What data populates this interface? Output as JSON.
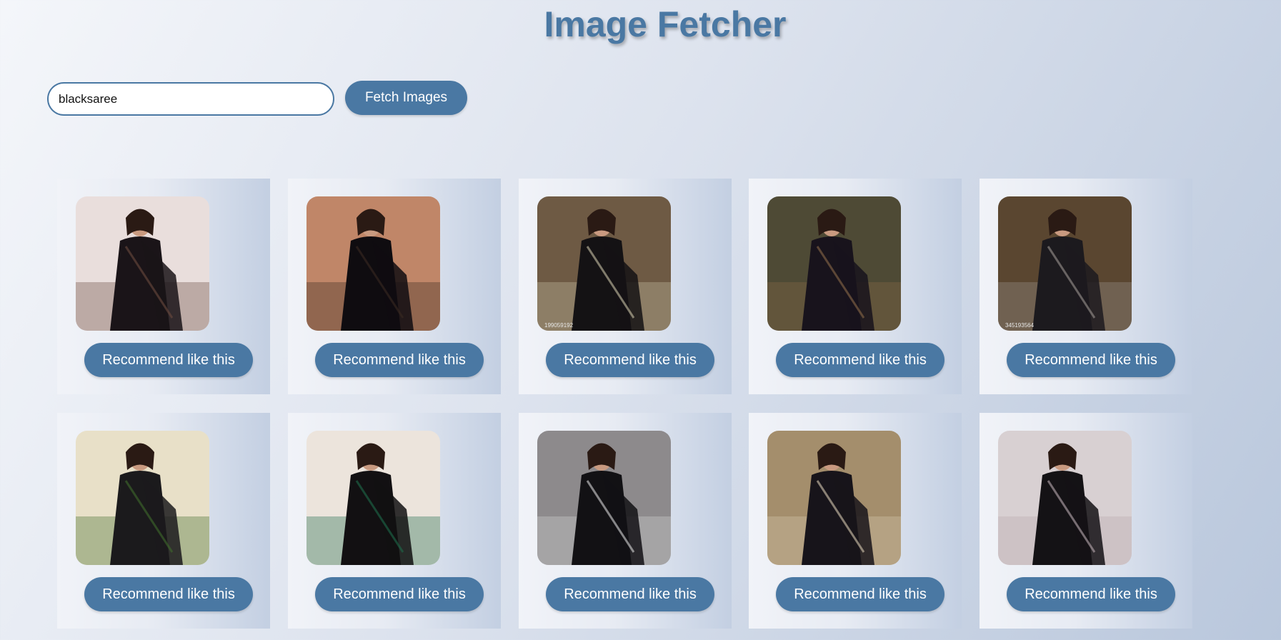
{
  "app": {
    "title": "Image Fetcher"
  },
  "search": {
    "value": "blacksaree",
    "button_label": "Fetch Images"
  },
  "results": [
    {
      "recommend_label": "Recommend like this",
      "bg": "#e9dedc",
      "figure": "#1a1418",
      "accent": "#6b4a3e",
      "caption": ""
    },
    {
      "recommend_label": "Recommend like this",
      "bg": "#c08668",
      "figure": "#0f0c10",
      "accent": "#3a2a22",
      "caption": ""
    },
    {
      "recommend_label": "Recommend like this",
      "bg": "#6e5a44",
      "figure": "#141214",
      "accent": "#c9c2a6",
      "caption": "199059192"
    },
    {
      "recommend_label": "Recommend like this",
      "bg": "#4e4a35",
      "figure": "#18131c",
      "accent": "#8a6a48",
      "caption": ""
    },
    {
      "recommend_label": "Recommend like this",
      "bg": "#5a4630",
      "figure": "#1c1a1e",
      "accent": "#9c9590",
      "caption": "345193564"
    },
    {
      "recommend_label": "Recommend like this",
      "bg": "#e8e0c8",
      "figure": "#1b1a1c",
      "accent": "#3f6b2c",
      "caption": ""
    },
    {
      "recommend_label": "Recommend like this",
      "bg": "#ece4dc",
      "figure": "#121012",
      "accent": "#1e6b4a",
      "caption": ""
    },
    {
      "recommend_label": "Recommend like this",
      "bg": "#8d8a8c",
      "figure": "#121114",
      "accent": "#d5d5d5",
      "caption": ""
    },
    {
      "recommend_label": "Recommend like this",
      "bg": "#a48e6c",
      "figure": "#17141a",
      "accent": "#d6c8b0",
      "caption": ""
    },
    {
      "recommend_label": "Recommend like this",
      "bg": "#d8d0d2",
      "figure": "#141215",
      "accent": "#b9aab0",
      "caption": ""
    }
  ]
}
